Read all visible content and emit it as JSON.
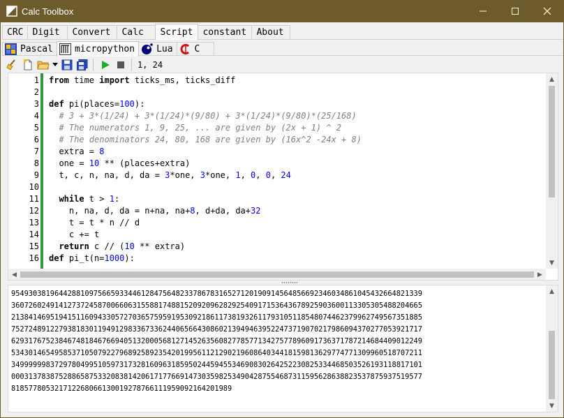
{
  "window": {
    "title": "Calc Toolbox"
  },
  "tabs": [
    {
      "label": "CRC",
      "active": false
    },
    {
      "label": "Digit",
      "active": false
    },
    {
      "label": "Convert",
      "active": false
    },
    {
      "label": "Calc",
      "active": false
    },
    {
      "label": "Script",
      "active": true
    },
    {
      "label": "constant",
      "active": false
    },
    {
      "label": "About",
      "active": false
    }
  ],
  "language_tabs": [
    {
      "label": "Pascal",
      "icon": "pascal-icon",
      "active": false
    },
    {
      "label": "micropython",
      "icon": "python-icon",
      "active": true
    },
    {
      "label": "Lua",
      "icon": "lua-icon",
      "active": false
    },
    {
      "label": "C",
      "icon": "c-language-icon",
      "active": false
    }
  ],
  "toolbar": {
    "cursor_position": "1, 24",
    "buttons": [
      "clear-icon",
      "new-file-icon",
      "open-folder-icon",
      "dropdown-arrow-icon",
      "save-icon",
      "save-all-icon",
      "run-icon",
      "stop-icon"
    ]
  },
  "editor": {
    "line_numbers": [
      "1",
      "2",
      "3",
      "4",
      "5",
      "6",
      "7",
      "8",
      "9",
      "10",
      "11",
      "12",
      "13",
      "14",
      "15",
      "16"
    ],
    "lines": [
      [
        {
          "t": "from",
          "c": "kw"
        },
        {
          "t": " time "
        },
        {
          "t": "import",
          "c": "kw"
        },
        {
          "t": " ticks_ms, ticks_diff"
        }
      ],
      [],
      [
        {
          "t": "def",
          "c": "kw"
        },
        {
          "t": " pi(places="
        },
        {
          "t": "100",
          "c": "num"
        },
        {
          "t": "):"
        }
      ],
      [
        {
          "t": "  # 3 + 3*(1/24) + 3*(1/24)*(9/80) + 3*(1/24)*(9/80)*(25/168)",
          "c": "cmt"
        }
      ],
      [
        {
          "t": "  # The numerators 1, 9, 25, ... are given by (2x + 1) ^ 2",
          "c": "cmt"
        }
      ],
      [
        {
          "t": "  # The denominators 24, 80, 168 are given by (16x^2 -24x + 8)",
          "c": "cmt"
        }
      ],
      [
        {
          "t": "  extra = "
        },
        {
          "t": "8",
          "c": "num"
        }
      ],
      [
        {
          "t": "  one = "
        },
        {
          "t": "10",
          "c": "num"
        },
        {
          "t": " ** (places+extra)"
        }
      ],
      [
        {
          "t": "  t, c, n, na, d, da = "
        },
        {
          "t": "3",
          "c": "num"
        },
        {
          "t": "*one, "
        },
        {
          "t": "3",
          "c": "num"
        },
        {
          "t": "*one, "
        },
        {
          "t": "1",
          "c": "num"
        },
        {
          "t": ", "
        },
        {
          "t": "0",
          "c": "num"
        },
        {
          "t": ", "
        },
        {
          "t": "0",
          "c": "num"
        },
        {
          "t": ", "
        },
        {
          "t": "24",
          "c": "num"
        }
      ],
      [],
      [
        {
          "t": "  "
        },
        {
          "t": "while",
          "c": "kw"
        },
        {
          "t": " t > "
        },
        {
          "t": "1",
          "c": "num"
        },
        {
          "t": ":"
        }
      ],
      [
        {
          "t": "    n, na, d, da = n+na, na+"
        },
        {
          "t": "8",
          "c": "num"
        },
        {
          "t": ", d+da, da+"
        },
        {
          "t": "32",
          "c": "num"
        }
      ],
      [
        {
          "t": "    t = t * n // d"
        }
      ],
      [
        {
          "t": "    c += t"
        }
      ],
      [
        {
          "t": "  "
        },
        {
          "t": "return",
          "c": "kw"
        },
        {
          "t": " c // ("
        },
        {
          "t": "10",
          "c": "num"
        },
        {
          "t": " ** extra)"
        }
      ],
      [
        {
          "t": "def",
          "c": "kw"
        },
        {
          "t": " pi_t(n="
        },
        {
          "t": "1000",
          "c": "num"
        },
        {
          "t": "):"
        }
      ]
    ]
  },
  "output": {
    "lines": [
      "9549303819644288109756659334461284756482337867831652712019091456485669234603486104543266482133​9",
      "3607260249141273724587006606315588174881520920962829254091715364367892590360011330530548820466​5",
      "2138414695194151160943305727036575959195309218611738193261179310511854807446237996274956735188​5",
      "7527248912279381830119491298336733624406566430860213949463952247371907021798609437027705392171​7",
      "6293176752384674818467669405132000568127145263560827785771342757789609173637178721468440901224​9",
      "5343014654958537105079227968925892354201995611212902196086403441815981362977477130996051870721​1",
      "3499999983729780499510597317328160963185950244594553469083026425223082533446850352619311881710​1",
      "0003137838752886587533208381420617177669147303598253490428755468731159562863882353787593751957​7",
      "818577805321712268066130019278766111959092164201989"
    ]
  }
}
